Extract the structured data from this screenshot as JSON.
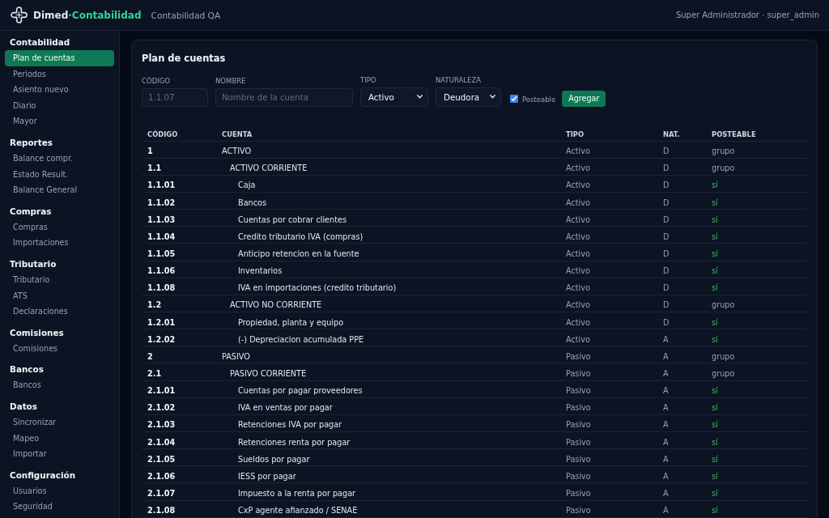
{
  "header": {
    "brand": {
      "name": "Dimed",
      "accent": "·Contabilidad"
    },
    "subtitle": "Contabilidad QA",
    "user": "Super Administrador · super_admin"
  },
  "sidebar": {
    "sections": [
      {
        "title": "Contabilidad",
        "items": [
          {
            "label": "Plan de cuentas",
            "selected": true
          },
          {
            "label": "Periodos",
            "selected": false
          },
          {
            "label": "Asiento nuevo",
            "selected": false
          },
          {
            "label": "Diario",
            "selected": false
          },
          {
            "label": "Mayor",
            "selected": false
          }
        ]
      },
      {
        "title": "Reportes",
        "items": [
          {
            "label": "Balance compr.",
            "selected": false
          },
          {
            "label": "Estado Result.",
            "selected": false
          },
          {
            "label": "Balance General",
            "selected": false
          }
        ]
      },
      {
        "title": "Compras",
        "items": [
          {
            "label": "Compras",
            "selected": false
          },
          {
            "label": "Importaciones",
            "selected": false
          }
        ]
      },
      {
        "title": "Tributario",
        "items": [
          {
            "label": "Tributario",
            "selected": false
          },
          {
            "label": "ATS",
            "selected": false
          },
          {
            "label": "Declaraciones",
            "selected": false
          }
        ]
      },
      {
        "title": "Comisiones",
        "items": [
          {
            "label": "Comisiones",
            "selected": false
          }
        ]
      },
      {
        "title": "Bancos",
        "items": [
          {
            "label": "Bancos",
            "selected": false
          }
        ]
      },
      {
        "title": "Datos",
        "items": [
          {
            "label": "Sincronizar",
            "selected": false
          },
          {
            "label": "Mapeo",
            "selected": false
          },
          {
            "label": "Importar",
            "selected": false
          }
        ]
      },
      {
        "title": "Configuración",
        "items": [
          {
            "label": "Usuarios",
            "selected": false
          },
          {
            "label": "Seguridad",
            "selected": false
          }
        ]
      }
    ]
  },
  "card": {
    "title": "Plan de cuentas",
    "form": {
      "fields": [
        {
          "kind": "input",
          "label": "CÓDIGO",
          "placeholder": "1.1.07"
        },
        {
          "kind": "input",
          "label": "NOMBRE",
          "placeholder": "Nombre de la cuenta"
        },
        {
          "kind": "select",
          "label": "TIPO",
          "value": "Activo"
        },
        {
          "kind": "select",
          "label": "NATURALEZA",
          "value": "Deudora"
        }
      ],
      "posteable": {
        "label": "Posteable",
        "checked": true
      },
      "submit": "Agregar"
    },
    "table": {
      "columns": [
        "CÓDIGO",
        "CUENTA",
        "TIPO",
        "NAT.",
        "POSTEABLE"
      ],
      "rows": [
        {
          "code": "1",
          "account": "ACTIVO",
          "type": "Activo",
          "nature": "D",
          "posteable": "grupo",
          "kind": "group",
          "children": [
            {
              "code": "1.1",
              "account": "ACTIVO CORRIENTE",
              "type": "Activo",
              "nature": "D",
              "posteable": "grupo",
              "kind": "group",
              "children": [
                {
                  "code": "1.1.01",
                  "account": "Caja",
                  "type": "Activo",
                  "nature": "D",
                  "posteable": "sí",
                  "kind": "account"
                },
                {
                  "code": "1.1.02",
                  "account": "Bancos",
                  "type": "Activo",
                  "nature": "D",
                  "posteable": "sí",
                  "kind": "account"
                },
                {
                  "code": "1.1.03",
                  "account": "Cuentas por cobrar clientes",
                  "type": "Activo",
                  "nature": "D",
                  "posteable": "sí",
                  "kind": "account"
                },
                {
                  "code": "1.1.04",
                  "account": "Credito tributario IVA (compras)",
                  "type": "Activo",
                  "nature": "D",
                  "posteable": "sí",
                  "kind": "account"
                },
                {
                  "code": "1.1.05",
                  "account": "Anticipo retencion en la fuente",
                  "type": "Activo",
                  "nature": "D",
                  "posteable": "sí",
                  "kind": "account"
                },
                {
                  "code": "1.1.06",
                  "account": "Inventarios",
                  "type": "Activo",
                  "nature": "D",
                  "posteable": "sí",
                  "kind": "account"
                },
                {
                  "code": "1.1.08",
                  "account": "IVA en importaciones (credito tributario)",
                  "type": "Activo",
                  "nature": "D",
                  "posteable": "sí",
                  "kind": "account"
                }
              ]
            },
            {
              "code": "1.2",
              "account": "ACTIVO NO CORRIENTE",
              "type": "Activo",
              "nature": "D",
              "posteable": "grupo",
              "kind": "group",
              "children": [
                {
                  "code": "1.2.01",
                  "account": "Propiedad, planta y equipo",
                  "type": "Activo",
                  "nature": "D",
                  "posteable": "sí",
                  "kind": "account"
                },
                {
                  "code": "1.2.02",
                  "account": "(-) Depreciacion acumulada PPE",
                  "type": "Activo",
                  "nature": "A",
                  "posteable": "sí",
                  "kind": "account"
                }
              ]
            }
          ]
        },
        {
          "code": "2",
          "account": "PASIVO",
          "type": "Pasivo",
          "nature": "A",
          "posteable": "grupo",
          "kind": "group",
          "children": [
            {
              "code": "2.1",
              "account": "PASIVO CORRIENTE",
              "type": "Pasivo",
              "nature": "A",
              "posteable": "grupo",
              "kind": "group",
              "children": [
                {
                  "code": "2.1.01",
                  "account": "Cuentas por pagar proveedores",
                  "type": "Pasivo",
                  "nature": "A",
                  "posteable": "sí",
                  "kind": "account"
                },
                {
                  "code": "2.1.02",
                  "account": "IVA en ventas por pagar",
                  "type": "Pasivo",
                  "nature": "A",
                  "posteable": "sí",
                  "kind": "account"
                },
                {
                  "code": "2.1.03",
                  "account": "Retenciones IVA por pagar",
                  "type": "Pasivo",
                  "nature": "A",
                  "posteable": "sí",
                  "kind": "account"
                },
                {
                  "code": "2.1.04",
                  "account": "Retenciones renta por pagar",
                  "type": "Pasivo",
                  "nature": "A",
                  "posteable": "sí",
                  "kind": "account"
                },
                {
                  "code": "2.1.05",
                  "account": "Sueldos por pagar",
                  "type": "Pasivo",
                  "nature": "A",
                  "posteable": "sí",
                  "kind": "account"
                },
                {
                  "code": "2.1.06",
                  "account": "IESS por pagar",
                  "type": "Pasivo",
                  "nature": "A",
                  "posteable": "sí",
                  "kind": "account"
                },
                {
                  "code": "2.1.07",
                  "account": "Impuesto a la renta por pagar",
                  "type": "Pasivo",
                  "nature": "A",
                  "posteable": "sí",
                  "kind": "account"
                },
                {
                  "code": "2.1.08",
                  "account": "CxP agente afianzado / SENAE",
                  "type": "Pasivo",
                  "nature": "A",
                  "posteable": "sí",
                  "kind": "account"
                }
              ]
            }
          ]
        }
      ]
    }
  }
}
